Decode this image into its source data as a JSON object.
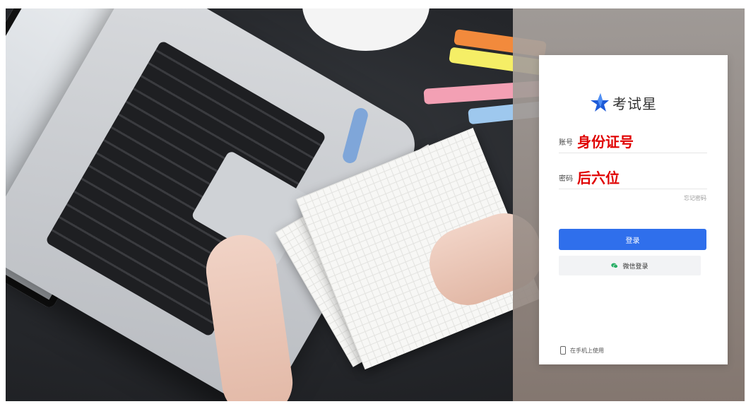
{
  "brand": {
    "name": "考试星"
  },
  "form": {
    "account_label": "账号",
    "account_value": "身份证号",
    "password_label": "密码",
    "password_value": "后六位",
    "forgot_label": "忘记密码",
    "login_label": "登录",
    "wechat_label": "微信登录"
  },
  "footer": {
    "mobile_label": "在手机上使用"
  },
  "colors": {
    "primary": "#2f6fec",
    "annotation": "#e00000",
    "logo_star": "#1e5bd8"
  }
}
